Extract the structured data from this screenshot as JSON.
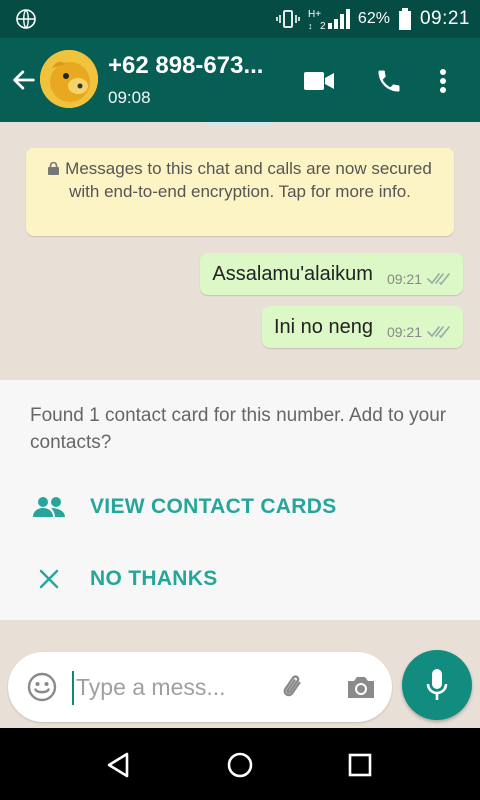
{
  "status_bar": {
    "network_type": "H+",
    "sim_slot": "2",
    "battery": "62%",
    "time": "09:21"
  },
  "header": {
    "contact_name": "+62 898-673...",
    "last_seen": "09:08",
    "icons": [
      "back-arrow-icon",
      "video-call-icon",
      "phone-icon",
      "more-vert-icon"
    ]
  },
  "chat": {
    "encryption_notice": "Messages to this chat and calls are now secured with end-to-end encryption. Tap for more info.",
    "messages": [
      {
        "text": "Assalamu'alaikum",
        "time": "09:21",
        "status": "delivered"
      },
      {
        "text": "Ini no neng",
        "time": "09:21",
        "status": "delivered"
      }
    ]
  },
  "contact_panel": {
    "prompt": "Found 1 contact card for this number. Add to your contacts?",
    "view_label": "VIEW CONTACT CARDS",
    "dismiss_label": "NO THANKS"
  },
  "composer": {
    "placeholder": "Type a mess..."
  },
  "colors": {
    "status_bar": "#054d44",
    "app_bar": "#075e54",
    "accent": "#26a69a",
    "mic_button": "#128c7e",
    "outgoing_bubble": "#dcf8c6",
    "notice_bubble": "#fdf4c5"
  }
}
